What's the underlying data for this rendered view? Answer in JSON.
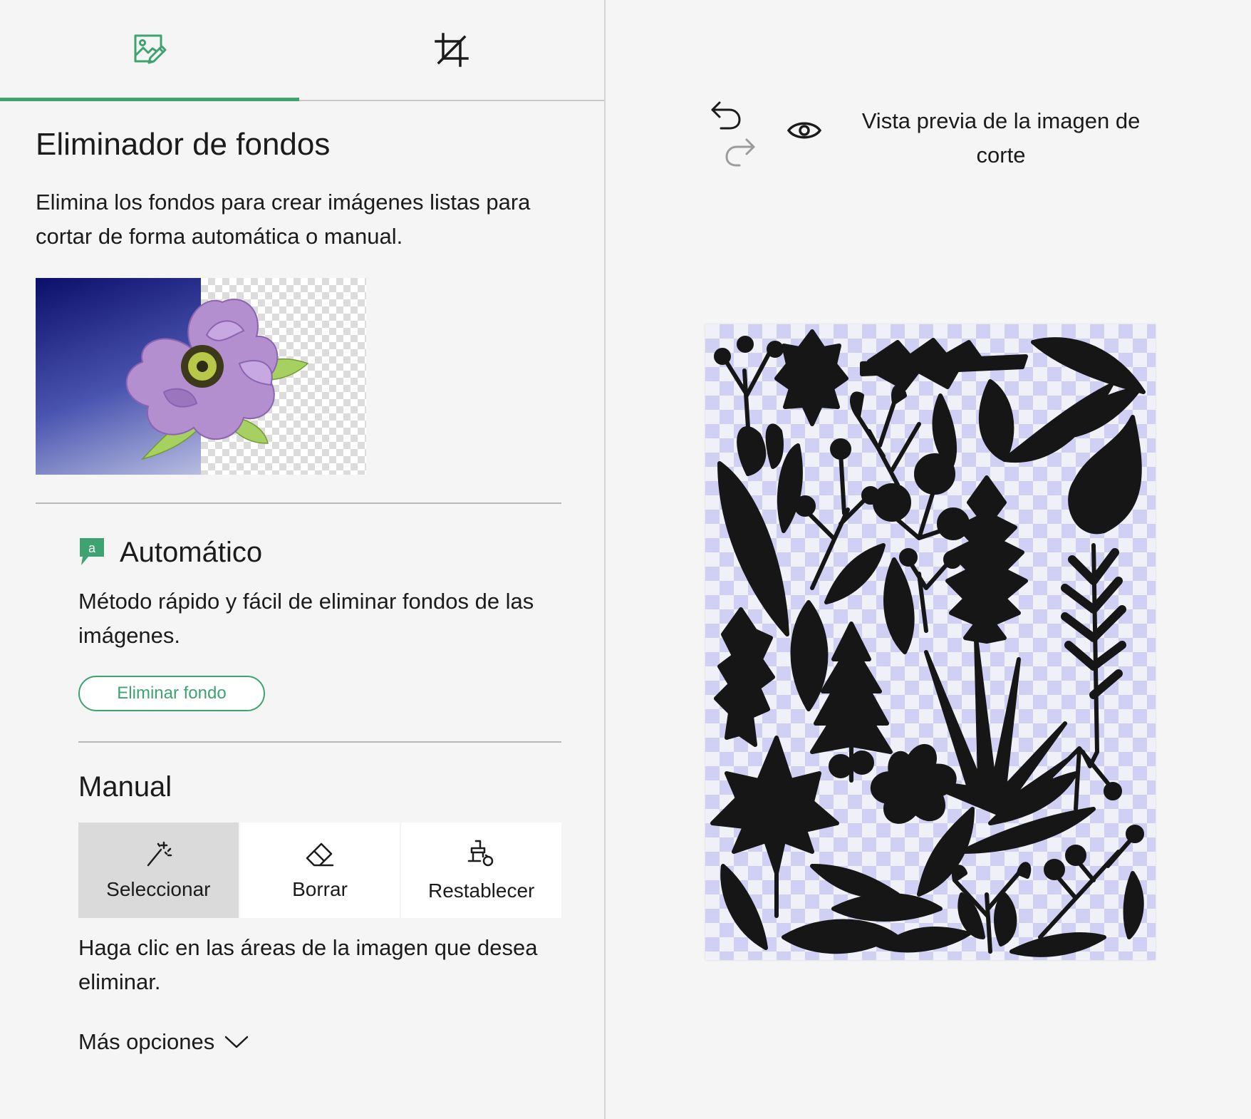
{
  "tabs": [
    {
      "name": "edit-image",
      "icon": "image-edit-icon",
      "active": true
    },
    {
      "name": "crop",
      "icon": "crop-icon",
      "active": false
    }
  ],
  "panel": {
    "title": "Eliminador de fondos",
    "description": "Elimina los fondos para crear imágenes listas para cortar de forma automática o manual."
  },
  "automatic": {
    "icon": "auto-badge-icon",
    "title": "Automático",
    "description": "Método rápido y fácil de eliminar fondos de las imágenes.",
    "button_label": "Eliminar fondo"
  },
  "manual": {
    "title": "Manual",
    "tools": [
      {
        "label": "Seleccionar",
        "icon": "magic-wand-icon",
        "active": true
      },
      {
        "label": "Borrar",
        "icon": "eraser-icon",
        "active": false
      },
      {
        "label": "Restablecer",
        "icon": "restore-brush-icon",
        "active": false
      }
    ],
    "instruction": "Haga clic en las áreas de la imagen que desea eliminar.",
    "more_options": "Más opciones"
  },
  "toolbar": {
    "undo_icon": "undo-icon",
    "redo_icon": "redo-icon",
    "preview_icon": "eye-icon",
    "preview_label": "Vista previa de la imagen de corte"
  },
  "colors": {
    "accent": "#3ea271",
    "silhouette": "#161616",
    "checker_canvas": "#cfd0f3"
  }
}
